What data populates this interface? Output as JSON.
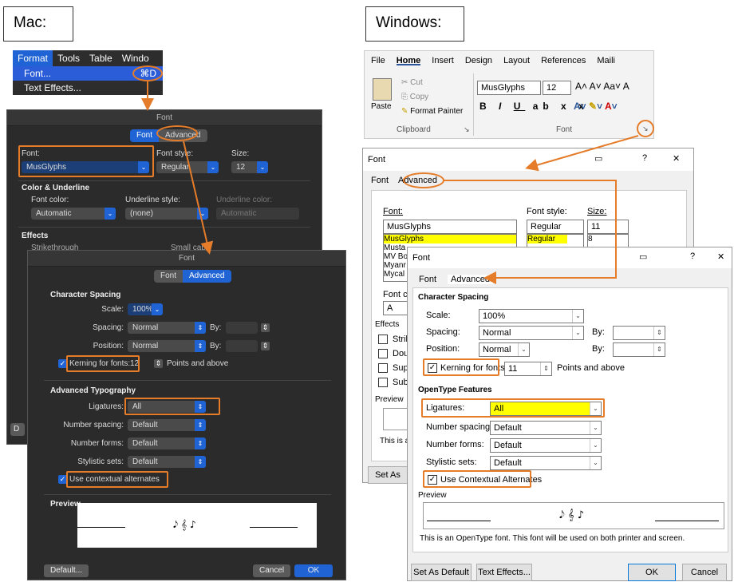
{
  "mac": {
    "heading": "Mac:",
    "menubar": [
      "Format",
      "Tools",
      "Table",
      "Windo"
    ],
    "menu": {
      "font_item": "Font...",
      "font_shortcut": "⌘D",
      "text_effects_item": "Text Effects..."
    },
    "dialog1": {
      "title": "Font",
      "tabs": [
        "Font",
        "Advanced"
      ],
      "font_label": "Font:",
      "font_value": "MusGlyphs",
      "style_label": "Font style:",
      "style_value": "Regular",
      "size_label": "Size:",
      "size_value": "12",
      "color_underline_heading": "Color & Underline",
      "font_color_label": "Font color:",
      "font_color_value": "Automatic",
      "underline_style_label": "Underline style:",
      "underline_style_value": "(none)",
      "underline_color_label": "Underline color:",
      "underline_color_value": "Automatic",
      "effects_heading": "Effects",
      "strikethrough": "Strikethrough",
      "small_caps": "Small caps",
      "default_button_partial": "D"
    },
    "dialog2": {
      "title": "Font",
      "tabs": [
        "Font",
        "Advanced"
      ],
      "char_spacing_heading": "Character Spacing",
      "scale_label": "Scale:",
      "scale_value": "100%",
      "spacing_label": "Spacing:",
      "spacing_value": "Normal",
      "position_label": "Position:",
      "position_value": "Normal",
      "by_label": "By:",
      "kerning_label": "Kerning for fonts:",
      "kerning_value": "12",
      "points_above": "Points and above",
      "adv_typo_heading": "Advanced Typography",
      "ligatures_label": "Ligatures:",
      "ligatures_value": "All",
      "number_spacing_label": "Number spacing:",
      "number_spacing_value": "Default",
      "number_forms_label": "Number forms:",
      "number_forms_value": "Default",
      "stylistic_sets_label": "Stylistic sets:",
      "stylistic_sets_value": "Default",
      "contextual_label": "Use contextual alternates",
      "preview_heading": "Preview",
      "preview_glyphs": "𝅘𝅥𝅮 𝄞 ♪",
      "default_button": "Default...",
      "cancel_button": "Cancel",
      "ok_button": "OK"
    }
  },
  "windows": {
    "heading": "Windows:",
    "ribbon": {
      "tabs": [
        "File",
        "Home",
        "Insert",
        "Design",
        "Layout",
        "References",
        "Maili"
      ],
      "paste": "Paste",
      "cut": "Cut",
      "copy": "Copy",
      "format_painter": "Format Painter",
      "clipboard_group": "Clipboard",
      "font_group": "Font",
      "font_name": "MusGlyphs",
      "font_size": "12"
    },
    "dialog1": {
      "title": "Font",
      "tabs": [
        "Font",
        "Advanced"
      ],
      "font_label": "Font:",
      "font_value": "MusGlyphs",
      "font_list": [
        "MusGlyphs",
        "Musta",
        "MV Bo",
        "Myanr",
        "Mycal"
      ],
      "style_label": "Font style:",
      "style_value": "Regular",
      "style_list": [
        "Regular",
        "Italic"
      ],
      "size_label": "Size:",
      "size_value": "11",
      "size_list": [
        "8",
        "9"
      ],
      "font_color_label": "Font c",
      "font_color_value": "A",
      "effects_heading": "Effects",
      "effects": [
        "Strike",
        "Doub",
        "Supe",
        "Subs"
      ],
      "preview_heading": "Preview",
      "preview_text_partial": "This is a",
      "set_default_partial": "Set As Def"
    },
    "dialog2": {
      "title": "Font",
      "tabs": [
        "Font",
        "Advanced"
      ],
      "char_spacing_heading": "Character Spacing",
      "scale_label": "Scale:",
      "scale_value": "100%",
      "spacing_label": "Spacing:",
      "spacing_value": "Normal",
      "position_label": "Position:",
      "position_value": "Normal",
      "by_label": "By:",
      "by2_label": "By:",
      "kerning_label": "Kerning for fonts:",
      "kerning_value": "11",
      "points_above": "Points and above",
      "opentype_heading": "OpenType Features",
      "ligatures_label": "Ligatures:",
      "ligatures_value": "All",
      "number_spacing_label": "Number spacing:",
      "number_spacing_value": "Default",
      "number_forms_label": "Number forms:",
      "number_forms_value": "Default",
      "stylistic_sets_label": "Stylistic sets:",
      "stylistic_sets_value": "Default",
      "contextual_label": "Use Contextual Alternates",
      "preview_heading": "Preview",
      "preview_glyphs": "𝅘𝅥𝅮 𝄞 ♪",
      "preview_text": "This is an OpenType font. This font will be used on both printer and screen.",
      "set_default_button": "Set As Default",
      "text_effects_button": "Text Effects...",
      "ok_button": "OK",
      "cancel_button": "Cancel",
      "help": "?",
      "close": "✕"
    }
  },
  "colors": {
    "highlight": "#e57c2a",
    "mac_blue": "#1f63d4",
    "yellow": "#ffff00"
  }
}
